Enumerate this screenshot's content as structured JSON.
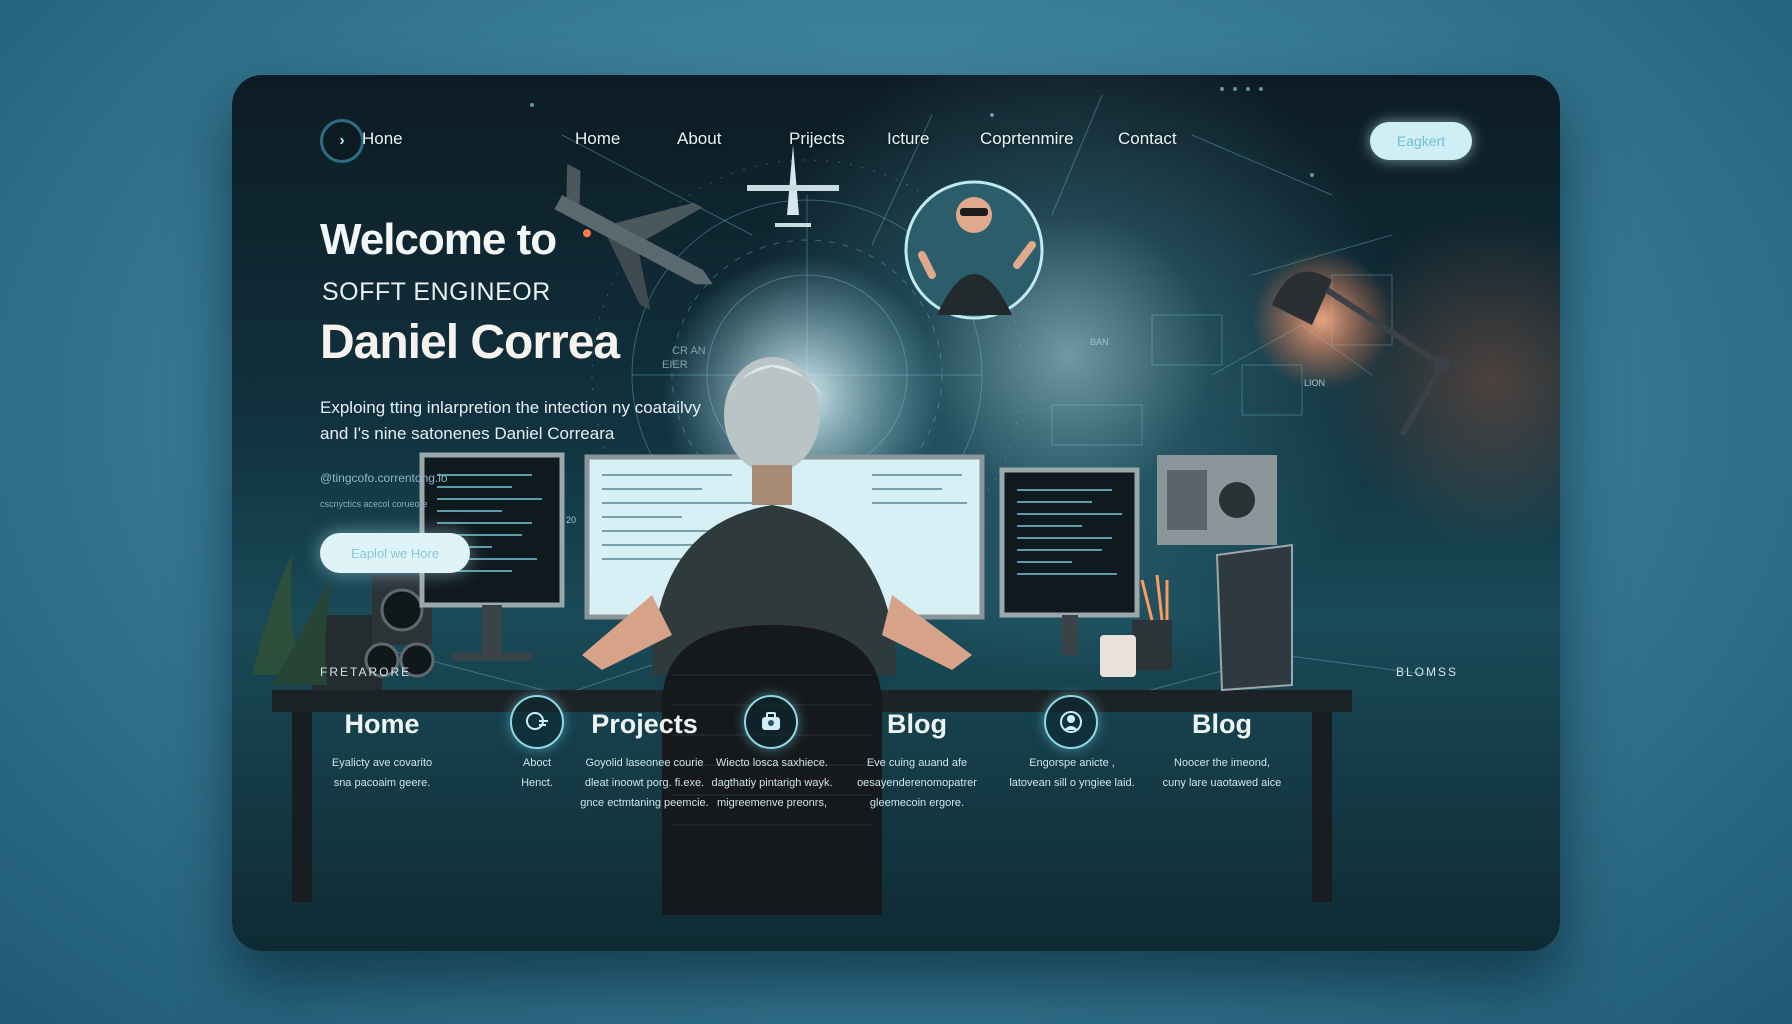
{
  "nav": {
    "home_button_glyph": "›",
    "links": [
      "Hone",
      "Home",
      "About",
      "Prijects",
      "Icture",
      "Coprtenmire",
      "Contact"
    ],
    "cta": "Eagkert"
  },
  "hero": {
    "welcome": "Welcome to",
    "role": "SOFFT ENGINEOR",
    "name": "Daniel Correa",
    "desc_line1": "Exploing tting inlarpretion the intection ny coatailvy",
    "desc_line2": "and I's nine satonenes Daniel Correara",
    "handle": "@tingcofo.correntong.io",
    "tags": "cscnyctics acecol corueore",
    "button": "Eaplol we Hore"
  },
  "scene_labels": {
    "lion": "LION",
    "ban": "BAN",
    "cran": "CR AN",
    "eier": "EIER",
    "twenty": "20"
  },
  "footer": {
    "left_label": "FRETARORE",
    "right_label": "BLOMSS",
    "features": [
      {
        "title": "Home",
        "lines": [
          "Eyalicty ave covarito",
          "sna pacoaim geere."
        ]
      },
      {
        "title": "",
        "lines": [
          "Aboct",
          "Henct."
        ]
      },
      {
        "title": "Projects",
        "lines": [
          "Goyolid laseonee courie",
          "dleat inoowt porg. fi.exe.",
          "gnce ectmtaning peemcie."
        ]
      },
      {
        "title": "",
        "lines": [
          "Wiecto losca saxhiece.",
          "dagthatiy pintarigh wayk.",
          "migreemenve preonrs,"
        ]
      },
      {
        "title": "Blog",
        "lines": [
          "Eve cuing auand afe",
          "oesayenderenomopatrer",
          "gleemecoin ergore."
        ]
      },
      {
        "title": "",
        "lines": [
          "Engorspe anicte ,",
          "latovean sill o yngiee laid."
        ]
      },
      {
        "title": "Blog",
        "lines": [
          "Noocer the imeond,",
          "cuny lare uaotawed aice"
        ]
      }
    ]
  },
  "colors": {
    "accent": "#8fd8e6",
    "cta_bg": "#cfeff6",
    "lamp": "#ff7a45"
  },
  "icons": [
    "chevron-right-icon",
    "chat-bubble-icon",
    "toolbox-icon",
    "user-circle-icon"
  ]
}
